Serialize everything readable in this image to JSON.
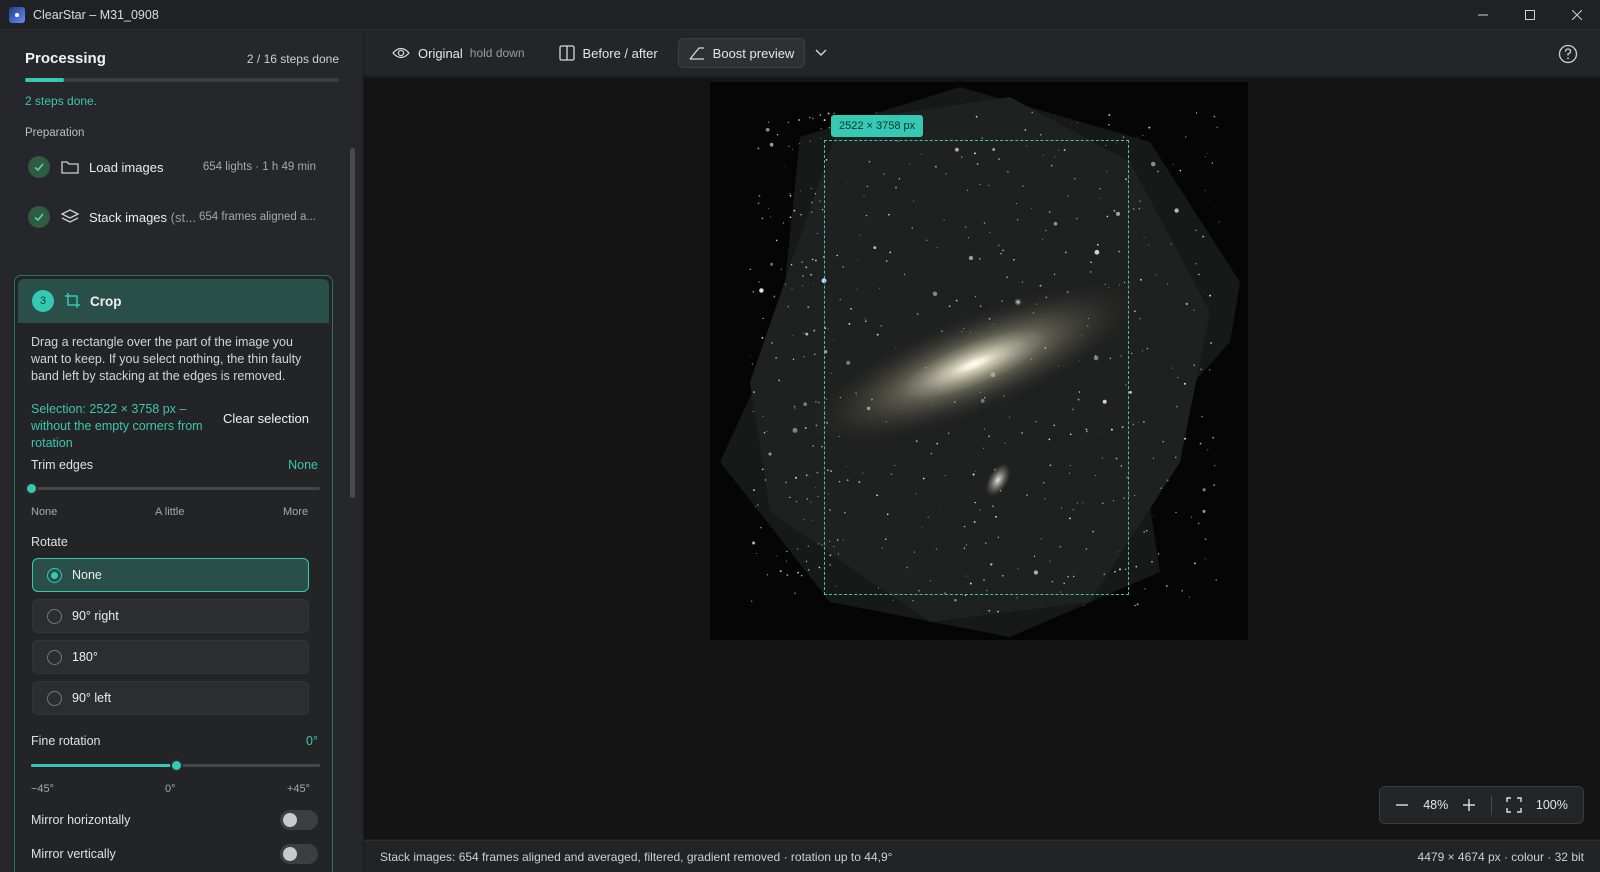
{
  "window": {
    "title": "ClearStar – M31_0908"
  },
  "sidebar": {
    "title": "Processing",
    "steps_count": "2 / 16 steps done",
    "progress": 0.125,
    "status": "2 steps done.",
    "section": "Preparation",
    "steps": [
      {
        "name": "Load images",
        "meta": "654 lights · 1 h 49 min"
      },
      {
        "name": "Stack images",
        "name_suffix": "(st...",
        "meta": "654 frames aligned a..."
      }
    ],
    "crop": {
      "number": "3",
      "title": "Crop",
      "description": "Drag a rectangle over the part of the image you want to keep. If you select nothing, the thin faulty band left by stacking at the edges is removed.",
      "selection": "Selection: 2522 × 3758 px – without the empty corners from rotation",
      "clear_label": "Clear selection",
      "trim": {
        "label": "Trim edges",
        "value": "None",
        "level": 0,
        "ticks": [
          "None",
          "A little",
          "More"
        ]
      },
      "rotate": {
        "label": "Rotate",
        "options": [
          "None",
          "90° right",
          "180°",
          "90° left"
        ],
        "selected": "None"
      },
      "fine_rotation": {
        "label": "Fine rotation",
        "value": "0°",
        "level": 0.5,
        "ticks": [
          "−45°",
          "0°",
          "+45°"
        ]
      },
      "mirror_h": {
        "label": "Mirror horizontally",
        "on": false
      },
      "mirror_v": {
        "label": "Mirror vertically",
        "on": false
      }
    }
  },
  "toolbar": {
    "original_label": "Original",
    "original_hint": "hold down",
    "before_after_label": "Before / after",
    "boost_label": "Boost preview"
  },
  "viewer": {
    "selection_badge": "2522 × 3758 px",
    "zoom_value": "48%",
    "zoom_full": "100%"
  },
  "statusbar": {
    "left": "Stack images: 654 frames aligned and averaged, filtered, gradient removed · rotation up to 44,9°",
    "right": "4479 × 4674 px · colour · 32 bit"
  },
  "colors": {
    "accent": "#35c9b3",
    "background": "#1c1d1f"
  }
}
